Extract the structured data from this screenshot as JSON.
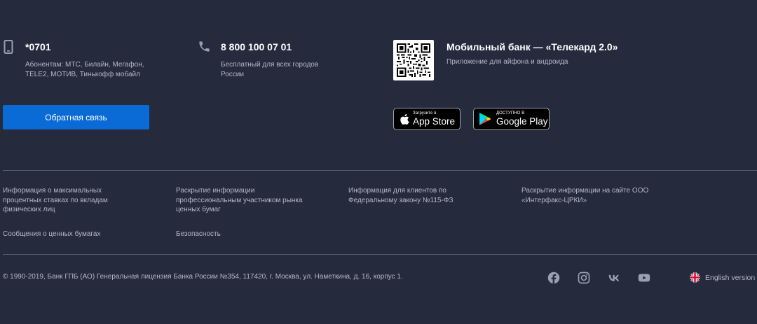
{
  "contacts": [
    {
      "icon": "mobile-phone-icon",
      "title": "*0701",
      "description": "Абонентам: МТС, Билайн, Мегафон, TELE2, МОТИВ, Тинькофф мобайл"
    },
    {
      "icon": "phone-handset-icon",
      "title": "8 800 100 07 01",
      "description": "Бесплатный для всех городов России"
    }
  ],
  "mobile_bank": {
    "title": "Мобильный банк — «Телекард 2.0»",
    "description": "Приложение для айфона и андроида",
    "qr_icon": "qr-code-icon"
  },
  "feedback_button": "Обратная связь",
  "stores": {
    "app_store": {
      "small": "Загрузите в",
      "big": "App Store"
    },
    "google_play": {
      "small": "ДОСТУПНО В",
      "big": "Google Play"
    }
  },
  "info_links": [
    "Информация о максимальных процентных ставках по вкладам физических лиц",
    "Раскрытие информации профессиональным участником рынка ценных бумаг",
    "Информация для клиентов по Федеральному закону №115-ФЗ",
    "Раскрытие информации на сайте ООО «Интерфакс-ЦРКИ»",
    "Сообщения о ценных бумагах",
    "Безопасность"
  ],
  "copyright": "© 1990-2019, Банк ГПБ (АО) Генеральная лицензия Банка России №354, 117420, г. Москва, ул. Наметкина, д. 16, корпус 1.",
  "social": [
    "facebook-icon",
    "instagram-icon",
    "vk-icon",
    "youtube-icon"
  ],
  "language": {
    "label": "English version",
    "icon": "uk-flag-icon"
  },
  "colors": {
    "background": "#252a3d",
    "primary_button": "#0a6ad6",
    "muted_text": "#b4b8c6",
    "divider": "#5a5f71",
    "icon": "#9aa0b2"
  }
}
